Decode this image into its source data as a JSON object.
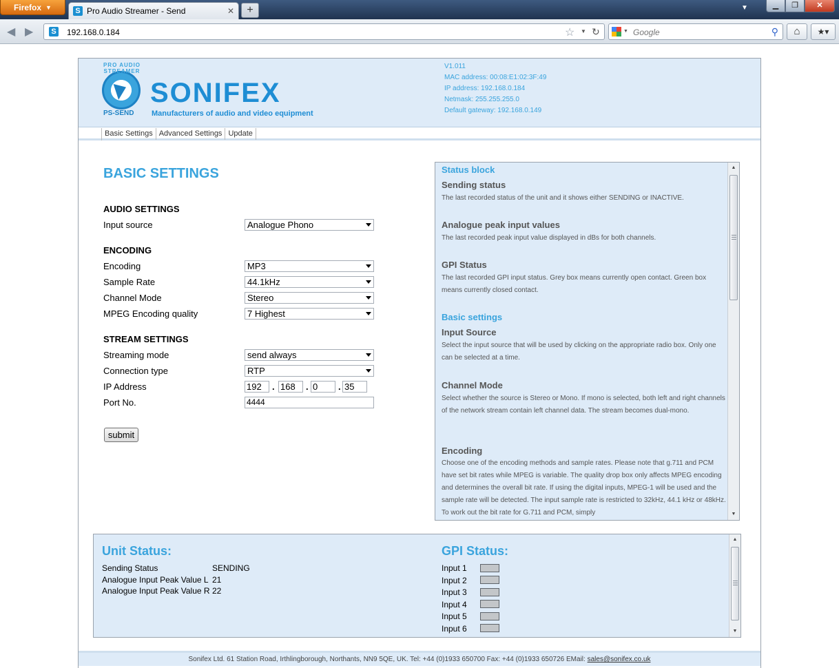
{
  "browser": {
    "app_button": "Firefox",
    "tab_title": "Pro Audio Streamer - Send",
    "new_tab": "+",
    "url": "192.168.0.184",
    "search_placeholder": "Google"
  },
  "header": {
    "badge_text": "PRO AUDIO STREAMER",
    "product_short": "PS-SEND",
    "brand": "SONIFEX",
    "tagline": "Manufacturers of audio and video equipment",
    "version": "V1.011",
    "mac": "MAC address: 00:08:E1:02:3F:49",
    "ip": "IP address: 192.168.0.184",
    "netmask": "Netmask: 255.255.255.0",
    "gateway": "Default gateway: 192.168.0.149"
  },
  "menu": {
    "basic": "Basic Settings",
    "advanced": "Advanced Settings",
    "update": "Update"
  },
  "settings": {
    "title": "BASIC SETTINGS",
    "audio_section": "AUDIO SETTINGS",
    "input_source_label": "Input source",
    "input_source_value": "Analogue Phono",
    "encoding_section": "ENCODING",
    "encoding_label": "Encoding",
    "encoding_value": "MP3",
    "sample_rate_label": "Sample Rate",
    "sample_rate_value": "44.1kHz",
    "channel_mode_label": "Channel Mode",
    "channel_mode_value": "Stereo",
    "mpeg_quality_label": "MPEG Encoding quality",
    "mpeg_quality_value": "7 Highest",
    "stream_section": "STREAM SETTINGS",
    "streaming_mode_label": "Streaming mode",
    "streaming_mode_value": "send always",
    "connection_type_label": "Connection type",
    "connection_type_value": "RTP",
    "ip_label": "IP Address",
    "ip_octets": [
      "192",
      "168",
      "0",
      "35"
    ],
    "ip_dot": ".",
    "port_label": "Port No.",
    "port_value": "4444",
    "submit": "submit"
  },
  "help": {
    "status_block": "Status block",
    "sending_status_title": "Sending status",
    "sending_status_text": "The last recorded status of the unit and it shows either SENDING or INACTIVE.",
    "peak_title": "Analogue peak input values",
    "peak_text": "The last recorded peak input value displayed in dBs for both channels.",
    "gpi_title": "GPI Status",
    "gpi_text": "The last recorded GPI input status. Grey box means currently open contact. Green box means currently closed contact.",
    "basic_settings": "Basic settings",
    "input_source_title": "Input Source",
    "input_source_text": "Select the input source that will be used by clicking on the appropriate radio box. Only one can be selected at a time.",
    "channel_mode_title": "Channel Mode",
    "channel_mode_text": "Select whether the source is Stereo or Mono. If mono is selected, both left and right channels of the network stream contain left channel data. The stream becomes dual-mono.",
    "encoding_title": "Encoding",
    "encoding_text": "Choose one of the encoding methods and sample rates. Please note that g.711 and PCM have set bit rates while MPEG is variable. The quality drop box only affects MPEG encoding and determines the overall bit rate. If using the digital inputs, MPEG-1 will be used and the sample rate will be detected. The input sample rate is restricted to 32kHz, 44.1 kHz or 48kHz. To work out the bit rate for G.711 and PCM, simply"
  },
  "unit_status": {
    "title": "Unit Status:",
    "sending_label": "Sending Status",
    "sending_value": "SENDING",
    "peak_l_label": "Analogue Input Peak Value L",
    "peak_l_value": "21",
    "peak_r_label": "Analogue Input Peak Value R",
    "peak_r_value": "22"
  },
  "gpi_status": {
    "title": "GPI Status:",
    "inputs": [
      "Input 1",
      "Input 2",
      "Input 3",
      "Input 4",
      "Input 5",
      "Input 6"
    ],
    "box_color": "#c3c6c9"
  },
  "footer": {
    "text": "Sonifex Ltd. 61 Station Road, Irthlingborough, Northants, NN9 5QE, UK. Tel: +44 (0)1933 650700 Fax: +44 (0)1933 650726 EMail:",
    "email": "sales@sonifex.co.uk"
  },
  "colors": {
    "accent": "#3aa4dd",
    "panel_bg": "#deebf8",
    "brand": "#1e8dd4"
  }
}
